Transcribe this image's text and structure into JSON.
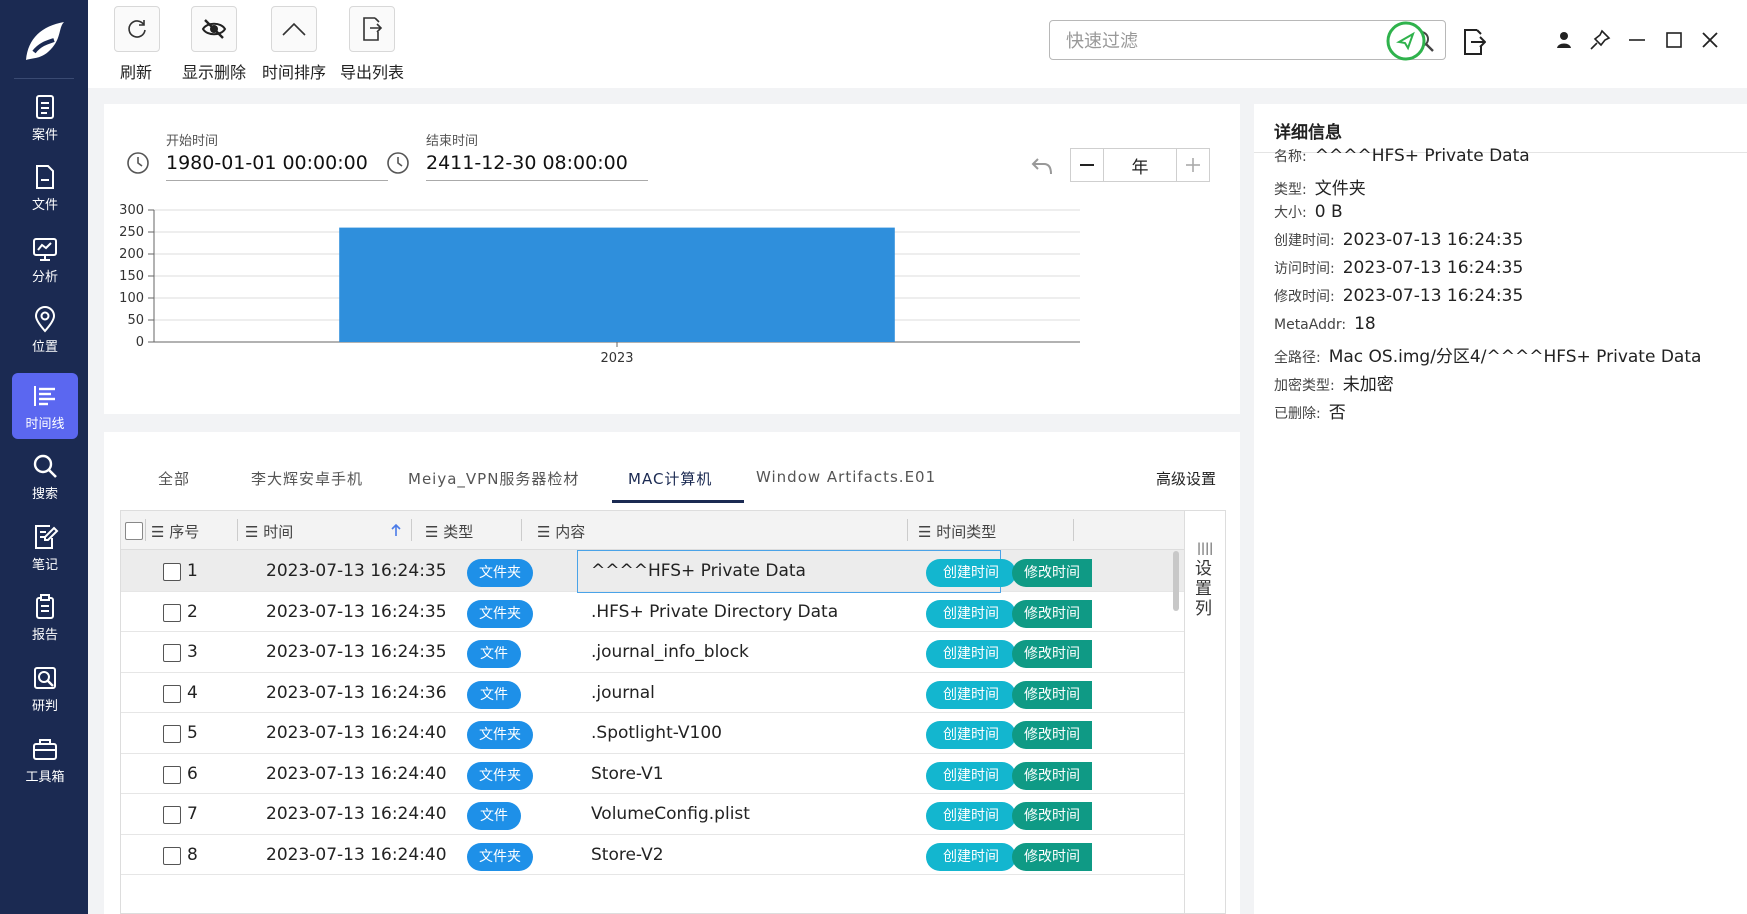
{
  "sidebar": {
    "items": [
      {
        "label": "案件",
        "icon": "case-icon"
      },
      {
        "label": "文件",
        "icon": "file-icon"
      },
      {
        "label": "分析",
        "icon": "analysis-icon"
      },
      {
        "label": "位置",
        "icon": "location-icon"
      },
      {
        "label": "时间线",
        "icon": "timeline-icon",
        "active": true
      },
      {
        "label": "搜索",
        "icon": "search-icon"
      },
      {
        "label": "笔记",
        "icon": "note-icon"
      },
      {
        "label": "报告",
        "icon": "report-icon"
      },
      {
        "label": "研判",
        "icon": "research-icon"
      },
      {
        "label": "工具箱",
        "icon": "toolbox-icon"
      }
    ]
  },
  "toolbar": {
    "refresh": "刷新",
    "show_deleted": "显示删除",
    "time_sort": "时间排序",
    "export_list": "导出列表"
  },
  "search": {
    "placeholder": "快速过滤"
  },
  "filter": {
    "start_label": "开始时间",
    "start_value": "1980-01-01 00:00:00",
    "end_label": "结束时间",
    "end_value": "2411-12-30 08:00:00",
    "zoom_unit": "年"
  },
  "chart_data": {
    "type": "bar",
    "categories": [
      "2023"
    ],
    "values": [
      260
    ],
    "ylim": [
      0,
      300
    ],
    "yticks": [
      0,
      50,
      100,
      150,
      200,
      250,
      300
    ],
    "grid": true,
    "color": "#2f8fdc"
  },
  "tabs": [
    {
      "label": "全部"
    },
    {
      "label": "李大辉安卓手机"
    },
    {
      "label": "Meiya_VPN服务器检材"
    },
    {
      "label": "MAC计算机",
      "active": true
    },
    {
      "label": "Window Artifacts.E01"
    }
  ],
  "advanced_settings": "高级设置",
  "table": {
    "headers": {
      "index": "序号",
      "time": "时间",
      "type": "类型",
      "content": "内容",
      "time_type": "时间类型"
    },
    "settings_col": "设置列",
    "created_tag": "创建时间",
    "modified_tag": "修改时间",
    "rows": [
      {
        "index": "1",
        "time": "2023-07-13 16:24:35",
        "type": "文件夹",
        "content": "^^^^HFS+ Private Data"
      },
      {
        "index": "2",
        "time": "2023-07-13 16:24:35",
        "type": "文件夹",
        "content": ".HFS+ Private Directory Data"
      },
      {
        "index": "3",
        "time": "2023-07-13 16:24:35",
        "type": "文件",
        "content": ".journal_info_block"
      },
      {
        "index": "4",
        "time": "2023-07-13 16:24:36",
        "type": "文件",
        "content": ".journal"
      },
      {
        "index": "5",
        "time": "2023-07-13 16:24:40",
        "type": "文件夹",
        "content": ".Spotlight-V100"
      },
      {
        "index": "6",
        "time": "2023-07-13 16:24:40",
        "type": "文件夹",
        "content": "Store-V1"
      },
      {
        "index": "7",
        "time": "2023-07-13 16:24:40",
        "type": "文件",
        "content": "VolumeConfig.plist"
      },
      {
        "index": "8",
        "time": "2023-07-13 16:24:40",
        "type": "文件夹",
        "content": "Store-V2"
      }
    ]
  },
  "detail": {
    "title": "详细信息",
    "fields": [
      {
        "key": "名称:",
        "value": "^^^^HFS+ Private Data"
      },
      {
        "key": "类型:",
        "value": "文件夹"
      },
      {
        "key": "大小:",
        "value": "0 B"
      },
      {
        "key": "创建时间:",
        "value": "2023-07-13 16:24:35"
      },
      {
        "key": "访问时间:",
        "value": "2023-07-13 16:24:35"
      },
      {
        "key": "修改时间:",
        "value": "2023-07-13 16:24:35"
      },
      {
        "key": "MetaAddr:",
        "value": "18"
      },
      {
        "key": "全路径:",
        "value": "Mac OS.img/分区4/^^^^HFS+ Private Data"
      },
      {
        "key": "加密类型:",
        "value": "未加密"
      },
      {
        "key": "已删除:",
        "value": "否"
      }
    ]
  }
}
